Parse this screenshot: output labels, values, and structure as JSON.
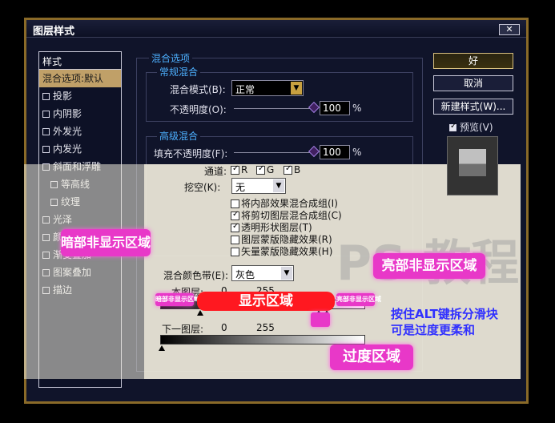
{
  "window": {
    "title": "图层样式",
    "close_label": "✕"
  },
  "styles_list": {
    "header": "样式",
    "items": [
      {
        "label": "混合选项:默认",
        "selected": true
      },
      {
        "label": "投影"
      },
      {
        "label": "内阴影"
      },
      {
        "label": "外发光"
      },
      {
        "label": "内发光"
      },
      {
        "label": "斜面和浮雕"
      },
      {
        "label": "等高线",
        "sub": true
      },
      {
        "label": "纹理",
        "sub": true
      },
      {
        "label": "光泽"
      },
      {
        "label": "颜色叠加"
      },
      {
        "label": "渐变叠加"
      },
      {
        "label": "图案叠加"
      },
      {
        "label": "描边"
      }
    ]
  },
  "blend_options": {
    "section_title": "混合选项",
    "general": {
      "title": "常规混合",
      "mode_label": "混合模式(B):",
      "mode_value": "正常",
      "opacity_label": "不透明度(O):",
      "opacity_value": "100",
      "percent": "%"
    },
    "advanced": {
      "title": "高级混合",
      "fill_label": "填充不透明度(F):",
      "fill_value": "100",
      "percent": "%",
      "channels_label": "通道:",
      "channels": [
        "R",
        "G",
        "B"
      ],
      "knockout_label": "挖空(K):",
      "knockout_value": "无",
      "options": [
        {
          "label": "将内部效果混合成组(I)",
          "checked": false
        },
        {
          "label": "将剪切图层混合成组(C)",
          "checked": true
        },
        {
          "label": "透明形状图层(T)",
          "checked": true
        },
        {
          "label": "图层蒙版隐藏效果(R)",
          "checked": false
        },
        {
          "label": "矢量蒙版隐藏效果(H)",
          "checked": false
        }
      ]
    },
    "blend_if": {
      "label": "混合颜色带(E):",
      "value": "灰色",
      "this_layer": "本图层:",
      "this_min": "0",
      "this_max": "255",
      "under_layer": "下一图层:",
      "under_min": "0",
      "under_max": "255"
    }
  },
  "buttons": {
    "ok": "好",
    "cancel": "取消",
    "new_style": "新建样式(W)...",
    "preview": "预览(V)"
  },
  "annotations": {
    "dark_hidden": "暗部非显示区域",
    "dark_hidden_small": "暗部非显示区域",
    "light_hidden": "亮部非显示区域",
    "light_hidden_small": "亮部非显示区域",
    "visible": "显示区域",
    "transition": "过度区域",
    "tip_line1": "按住ALT键拆分滑块",
    "tip_line2": "可是过度更柔和",
    "watermark": "PS 教程"
  },
  "colors": {
    "accent_pink": "#e838c8",
    "accent_red": "#ff1820",
    "tip_blue": "#3030ff",
    "selected": "#c0a068"
  }
}
